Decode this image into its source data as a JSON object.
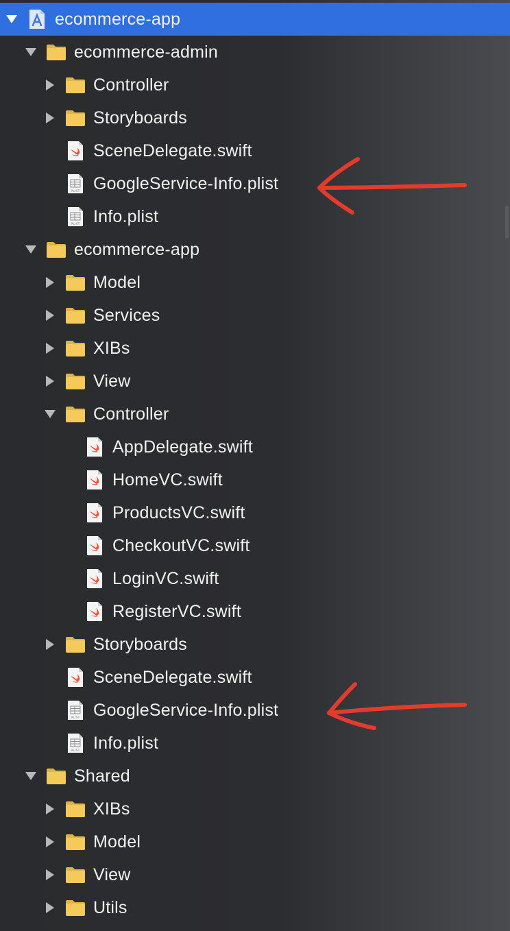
{
  "navigator": {
    "rows": [
      {
        "label": "ecommerce-app",
        "level": 0,
        "type": "project",
        "expanded": true,
        "selected": true
      },
      {
        "label": "ecommerce-admin",
        "level": 1,
        "type": "folder",
        "expanded": true
      },
      {
        "label": "Controller",
        "level": 2,
        "type": "folder",
        "expanded": false
      },
      {
        "label": "Storyboards",
        "level": 2,
        "type": "folder",
        "expanded": false
      },
      {
        "label": "SceneDelegate.swift",
        "level": 2,
        "type": "swift"
      },
      {
        "label": "GoogleService-Info.plist",
        "level": 2,
        "type": "plist"
      },
      {
        "label": "Info.plist",
        "level": 2,
        "type": "plist"
      },
      {
        "label": "ecommerce-app",
        "level": 1,
        "type": "folder",
        "expanded": true
      },
      {
        "label": "Model",
        "level": 2,
        "type": "folder",
        "expanded": false
      },
      {
        "label": "Services",
        "level": 2,
        "type": "folder",
        "expanded": false
      },
      {
        "label": "XIBs",
        "level": 2,
        "type": "folder",
        "expanded": false
      },
      {
        "label": "View",
        "level": 2,
        "type": "folder",
        "expanded": false
      },
      {
        "label": "Controller",
        "level": 2,
        "type": "folder",
        "expanded": true
      },
      {
        "label": "AppDelegate.swift",
        "level": 3,
        "type": "swift"
      },
      {
        "label": "HomeVC.swift",
        "level": 3,
        "type": "swift"
      },
      {
        "label": "ProductsVC.swift",
        "level": 3,
        "type": "swift"
      },
      {
        "label": "CheckoutVC.swift",
        "level": 3,
        "type": "swift"
      },
      {
        "label": "LoginVC.swift",
        "level": 3,
        "type": "swift"
      },
      {
        "label": "RegisterVC.swift",
        "level": 3,
        "type": "swift"
      },
      {
        "label": "Storyboards",
        "level": 2,
        "type": "folder",
        "expanded": false
      },
      {
        "label": "SceneDelegate.swift",
        "level": 2,
        "type": "swift"
      },
      {
        "label": "GoogleService-Info.plist",
        "level": 2,
        "type": "plist"
      },
      {
        "label": "Info.plist",
        "level": 2,
        "type": "plist"
      },
      {
        "label": "Shared",
        "level": 1,
        "type": "folder",
        "expanded": true
      },
      {
        "label": "XIBs",
        "level": 2,
        "type": "folder",
        "expanded": false
      },
      {
        "label": "Model",
        "level": 2,
        "type": "folder",
        "expanded": false
      },
      {
        "label": "View",
        "level": 2,
        "type": "folder",
        "expanded": false
      },
      {
        "label": "Utils",
        "level": 2,
        "type": "folder",
        "expanded": false
      }
    ]
  },
  "icons": {
    "folder": "folder-icon",
    "swift": "swift-file-icon",
    "plist": "plist-file-icon",
    "project": "xcode-project-icon",
    "expanded": "disclosure-triangle-down-icon",
    "collapsed": "disclosure-triangle-right-icon"
  },
  "icon_text": {
    "plist": "PLIST"
  },
  "annotations": [
    {
      "type": "red-arrow",
      "points_to_row": 5
    },
    {
      "type": "red-arrow",
      "points_to_row": 21
    }
  ],
  "colors": {
    "selection": "#2f6fe0",
    "text": "#f1f1f1",
    "folder": "#f5c95a",
    "swift": "#f05138",
    "arrow": "#e53b2c"
  }
}
